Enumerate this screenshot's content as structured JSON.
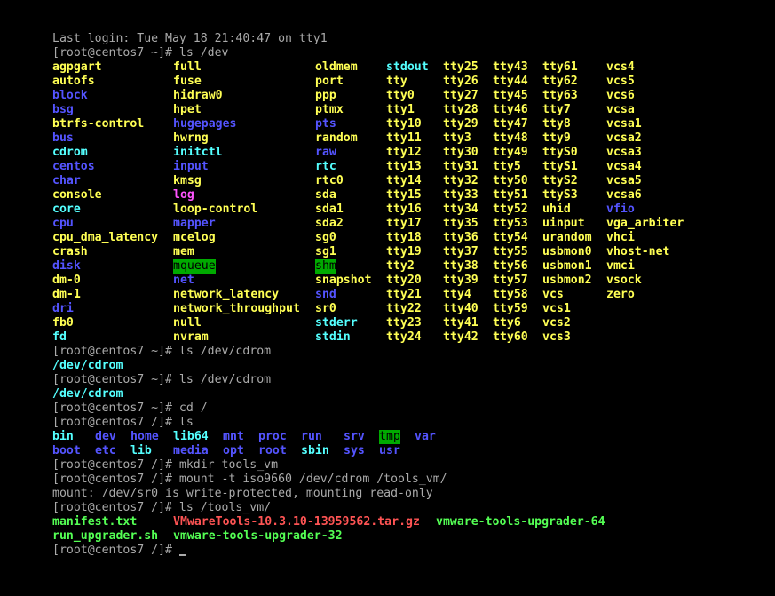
{
  "colors": {
    "background": "#000000",
    "text": "#aaaaaa",
    "device": "#ffff54",
    "directory": "#5454ff",
    "symlink": "#54ffff",
    "socket": "#ff54ff",
    "sticky_dir_bg": "#00aa00",
    "executable": "#54ff54",
    "archive": "#ff5454"
  },
  "terminal": {
    "lines": [
      {
        "text": "Last login: Tue May 18 21:40:47 on tty1"
      },
      {
        "text": "[root@centos7 ~]# ls /dev"
      },
      {
        "grid": "dev",
        "row": 0
      },
      {
        "grid": "dev",
        "row": 1
      },
      {
        "grid": "dev",
        "row": 2
      },
      {
        "grid": "dev",
        "row": 3
      },
      {
        "grid": "dev",
        "row": 4
      },
      {
        "grid": "dev",
        "row": 5
      },
      {
        "grid": "dev",
        "row": 6
      },
      {
        "grid": "dev",
        "row": 7
      },
      {
        "grid": "dev",
        "row": 8
      },
      {
        "grid": "dev",
        "row": 9
      },
      {
        "grid": "dev",
        "row": 10
      },
      {
        "grid": "dev",
        "row": 11
      },
      {
        "grid": "dev",
        "row": 12
      },
      {
        "grid": "dev",
        "row": 13
      },
      {
        "grid": "dev",
        "row": 14
      },
      {
        "grid": "dev",
        "row": 15
      },
      {
        "grid": "dev",
        "row": 16
      },
      {
        "grid": "dev",
        "row": 17
      },
      {
        "grid": "dev",
        "row": 18
      },
      {
        "grid": "dev",
        "row": 19
      },
      {
        "text": "[root@centos7 ~]# ls /dev/cdrom"
      },
      {
        "text": "/dev/cdrom",
        "c": "link"
      },
      {
        "text": "[root@centos7 ~]# ls /dev/cdrom"
      },
      {
        "text": "/dev/cdrom",
        "c": "link"
      },
      {
        "text": "[root@centos7 ~]# cd /"
      },
      {
        "text": "[root@centos7 /]# ls"
      },
      {
        "grid": "root",
        "row": 0
      },
      {
        "grid": "root",
        "row": 1
      },
      {
        "text": "[root@centos7 /]# mkdir tools_vm"
      },
      {
        "text": "[root@centos7 /]# mount -t iso9660 /dev/cdrom /tools_vm/"
      },
      {
        "text": "mount: /dev/sr0 is write-protected, mounting read-only"
      },
      {
        "text": "[root@centos7 /]# ls /tools_vm/"
      },
      {
        "grid": "tools",
        "row": 0
      },
      {
        "grid": "tools",
        "row": 1
      },
      {
        "text": "[root@centos7 /]# ",
        "cursor": true
      }
    ],
    "listings": {
      "dev": [
        [
          {
            "t": "agpgart",
            "c": "dev"
          },
          {
            "t": "autofs",
            "c": "dev"
          },
          {
            "t": "block",
            "c": "dir"
          },
          {
            "t": "bsg",
            "c": "dir"
          },
          {
            "t": "btrfs-control",
            "c": "dev"
          },
          {
            "t": "bus",
            "c": "dir"
          },
          {
            "t": "cdrom",
            "c": "link"
          },
          {
            "t": "centos",
            "c": "dir"
          },
          {
            "t": "char",
            "c": "dir"
          },
          {
            "t": "console",
            "c": "dev"
          },
          {
            "t": "core",
            "c": "link"
          },
          {
            "t": "cpu",
            "c": "dir"
          },
          {
            "t": "cpu_dma_latency",
            "c": "dev"
          },
          {
            "t": "crash",
            "c": "dev"
          },
          {
            "t": "disk",
            "c": "dir"
          },
          {
            "t": "dm-0",
            "c": "dev"
          },
          {
            "t": "dm-1",
            "c": "dev"
          },
          {
            "t": "dri",
            "c": "dir"
          },
          {
            "t": "fb0",
            "c": "dev"
          },
          {
            "t": "fd",
            "c": "link"
          }
        ],
        [
          {
            "t": "full",
            "c": "dev"
          },
          {
            "t": "fuse",
            "c": "dev"
          },
          {
            "t": "hidraw0",
            "c": "dev"
          },
          {
            "t": "hpet",
            "c": "dev"
          },
          {
            "t": "hugepages",
            "c": "dir"
          },
          {
            "t": "hwrng",
            "c": "dev"
          },
          {
            "t": "initctl",
            "c": "link"
          },
          {
            "t": "input",
            "c": "dir"
          },
          {
            "t": "kmsg",
            "c": "dev"
          },
          {
            "t": "log",
            "c": "sock"
          },
          {
            "t": "loop-control",
            "c": "dev"
          },
          {
            "t": "mapper",
            "c": "dir"
          },
          {
            "t": "mcelog",
            "c": "dev"
          },
          {
            "t": "mem",
            "c": "dev"
          },
          {
            "t": "mqueue",
            "c": "sticky"
          },
          {
            "t": "net",
            "c": "dir"
          },
          {
            "t": "network_latency",
            "c": "dev"
          },
          {
            "t": "network_throughput",
            "c": "dev"
          },
          {
            "t": "null",
            "c": "dev"
          },
          {
            "t": "nvram",
            "c": "dev"
          }
        ],
        [
          {
            "t": "oldmem",
            "c": "dev"
          },
          {
            "t": "port",
            "c": "dev"
          },
          {
            "t": "ppp",
            "c": "dev"
          },
          {
            "t": "ptmx",
            "c": "dev"
          },
          {
            "t": "pts",
            "c": "dir"
          },
          {
            "t": "random",
            "c": "dev"
          },
          {
            "t": "raw",
            "c": "dir"
          },
          {
            "t": "rtc",
            "c": "link"
          },
          {
            "t": "rtc0",
            "c": "dev"
          },
          {
            "t": "sda",
            "c": "dev"
          },
          {
            "t": "sda1",
            "c": "dev"
          },
          {
            "t": "sda2",
            "c": "dev"
          },
          {
            "t": "sg0",
            "c": "dev"
          },
          {
            "t": "sg1",
            "c": "dev"
          },
          {
            "t": "shm",
            "c": "sticky"
          },
          {
            "t": "snapshot",
            "c": "dev"
          },
          {
            "t": "snd",
            "c": "dir"
          },
          {
            "t": "sr0",
            "c": "dev"
          },
          {
            "t": "stderr",
            "c": "link"
          },
          {
            "t": "stdin",
            "c": "link"
          }
        ],
        [
          {
            "t": "stdout",
            "c": "link"
          },
          {
            "t": "tty",
            "c": "dev"
          },
          {
            "t": "tty0",
            "c": "dev"
          },
          {
            "t": "tty1",
            "c": "dev"
          },
          {
            "t": "tty10",
            "c": "dev"
          },
          {
            "t": "tty11",
            "c": "dev"
          },
          {
            "t": "tty12",
            "c": "dev"
          },
          {
            "t": "tty13",
            "c": "dev"
          },
          {
            "t": "tty14",
            "c": "dev"
          },
          {
            "t": "tty15",
            "c": "dev"
          },
          {
            "t": "tty16",
            "c": "dev"
          },
          {
            "t": "tty17",
            "c": "dev"
          },
          {
            "t": "tty18",
            "c": "dev"
          },
          {
            "t": "tty19",
            "c": "dev"
          },
          {
            "t": "tty2",
            "c": "dev"
          },
          {
            "t": "tty20",
            "c": "dev"
          },
          {
            "t": "tty21",
            "c": "dev"
          },
          {
            "t": "tty22",
            "c": "dev"
          },
          {
            "t": "tty23",
            "c": "dev"
          },
          {
            "t": "tty24",
            "c": "dev"
          }
        ],
        [
          {
            "t": "tty25",
            "c": "dev"
          },
          {
            "t": "tty26",
            "c": "dev"
          },
          {
            "t": "tty27",
            "c": "dev"
          },
          {
            "t": "tty28",
            "c": "dev"
          },
          {
            "t": "tty29",
            "c": "dev"
          },
          {
            "t": "tty3",
            "c": "dev"
          },
          {
            "t": "tty30",
            "c": "dev"
          },
          {
            "t": "tty31",
            "c": "dev"
          },
          {
            "t": "tty32",
            "c": "dev"
          },
          {
            "t": "tty33",
            "c": "dev"
          },
          {
            "t": "tty34",
            "c": "dev"
          },
          {
            "t": "tty35",
            "c": "dev"
          },
          {
            "t": "tty36",
            "c": "dev"
          },
          {
            "t": "tty37",
            "c": "dev"
          },
          {
            "t": "tty38",
            "c": "dev"
          },
          {
            "t": "tty39",
            "c": "dev"
          },
          {
            "t": "tty4",
            "c": "dev"
          },
          {
            "t": "tty40",
            "c": "dev"
          },
          {
            "t": "tty41",
            "c": "dev"
          },
          {
            "t": "tty42",
            "c": "dev"
          }
        ],
        [
          {
            "t": "tty43",
            "c": "dev"
          },
          {
            "t": "tty44",
            "c": "dev"
          },
          {
            "t": "tty45",
            "c": "dev"
          },
          {
            "t": "tty46",
            "c": "dev"
          },
          {
            "t": "tty47",
            "c": "dev"
          },
          {
            "t": "tty48",
            "c": "dev"
          },
          {
            "t": "tty49",
            "c": "dev"
          },
          {
            "t": "tty5",
            "c": "dev"
          },
          {
            "t": "tty50",
            "c": "dev"
          },
          {
            "t": "tty51",
            "c": "dev"
          },
          {
            "t": "tty52",
            "c": "dev"
          },
          {
            "t": "tty53",
            "c": "dev"
          },
          {
            "t": "tty54",
            "c": "dev"
          },
          {
            "t": "tty55",
            "c": "dev"
          },
          {
            "t": "tty56",
            "c": "dev"
          },
          {
            "t": "tty57",
            "c": "dev"
          },
          {
            "t": "tty58",
            "c": "dev"
          },
          {
            "t": "tty59",
            "c": "dev"
          },
          {
            "t": "tty6",
            "c": "dev"
          },
          {
            "t": "tty60",
            "c": "dev"
          }
        ],
        [
          {
            "t": "tty61",
            "c": "dev"
          },
          {
            "t": "tty62",
            "c": "dev"
          },
          {
            "t": "tty63",
            "c": "dev"
          },
          {
            "t": "tty7",
            "c": "dev"
          },
          {
            "t": "tty8",
            "c": "dev"
          },
          {
            "t": "tty9",
            "c": "dev"
          },
          {
            "t": "ttyS0",
            "c": "dev"
          },
          {
            "t": "ttyS1",
            "c": "dev"
          },
          {
            "t": "ttyS2",
            "c": "dev"
          },
          {
            "t": "ttyS3",
            "c": "dev"
          },
          {
            "t": "uhid",
            "c": "dev"
          },
          {
            "t": "uinput",
            "c": "dev"
          },
          {
            "t": "urandom",
            "c": "dev"
          },
          {
            "t": "usbmon0",
            "c": "dev"
          },
          {
            "t": "usbmon1",
            "c": "dev"
          },
          {
            "t": "usbmon2",
            "c": "dev"
          },
          {
            "t": "vcs",
            "c": "dev"
          },
          {
            "t": "vcs1",
            "c": "dev"
          },
          {
            "t": "vcs2",
            "c": "dev"
          },
          {
            "t": "vcs3",
            "c": "dev"
          }
        ],
        [
          {
            "t": "vcs4",
            "c": "dev"
          },
          {
            "t": "vcs5",
            "c": "dev"
          },
          {
            "t": "vcs6",
            "c": "dev"
          },
          {
            "t": "vcsa",
            "c": "dev"
          },
          {
            "t": "vcsa1",
            "c": "dev"
          },
          {
            "t": "vcsa2",
            "c": "dev"
          },
          {
            "t": "vcsa3",
            "c": "dev"
          },
          {
            "t": "vcsa4",
            "c": "dev"
          },
          {
            "t": "vcsa5",
            "c": "dev"
          },
          {
            "t": "vcsa6",
            "c": "dev"
          },
          {
            "t": "vfio",
            "c": "dir"
          },
          {
            "t": "vga_arbiter",
            "c": "dev"
          },
          {
            "t": "vhci",
            "c": "dev"
          },
          {
            "t": "vhost-net",
            "c": "dev"
          },
          {
            "t": "vmci",
            "c": "dev"
          },
          {
            "t": "vsock",
            "c": "dev"
          },
          {
            "t": "zero",
            "c": "dev"
          }
        ]
      ],
      "root": [
        [
          {
            "t": "bin",
            "c": "link"
          },
          {
            "t": "boot",
            "c": "dir"
          }
        ],
        [
          {
            "t": "dev",
            "c": "dir"
          },
          {
            "t": "etc",
            "c": "dir"
          }
        ],
        [
          {
            "t": "home",
            "c": "dir"
          },
          {
            "t": "lib",
            "c": "link"
          }
        ],
        [
          {
            "t": "lib64",
            "c": "link"
          },
          {
            "t": "media",
            "c": "dir"
          }
        ],
        [
          {
            "t": "mnt",
            "c": "dir"
          },
          {
            "t": "opt",
            "c": "dir"
          }
        ],
        [
          {
            "t": "proc",
            "c": "dir"
          },
          {
            "t": "root",
            "c": "dir"
          }
        ],
        [
          {
            "t": "run",
            "c": "dir"
          },
          {
            "t": "sbin",
            "c": "link"
          }
        ],
        [
          {
            "t": "srv",
            "c": "dir"
          },
          {
            "t": "sys",
            "c": "dir"
          }
        ],
        [
          {
            "t": "tmp",
            "c": "sticky"
          },
          {
            "t": "usr",
            "c": "dir"
          }
        ],
        [
          {
            "t": "var",
            "c": "dir"
          }
        ]
      ],
      "tools": [
        [
          {
            "t": "manifest.txt",
            "c": "exe"
          },
          {
            "t": "run_upgrader.sh",
            "c": "exe"
          }
        ],
        [
          {
            "t": "VMwareTools-10.3.10-13959562.tar.gz",
            "c": "archive"
          },
          {
            "t": "vmware-tools-upgrader-32",
            "c": "exe"
          }
        ],
        [
          {
            "t": "vmware-tools-upgrader-64",
            "c": "exe"
          }
        ]
      ]
    }
  }
}
